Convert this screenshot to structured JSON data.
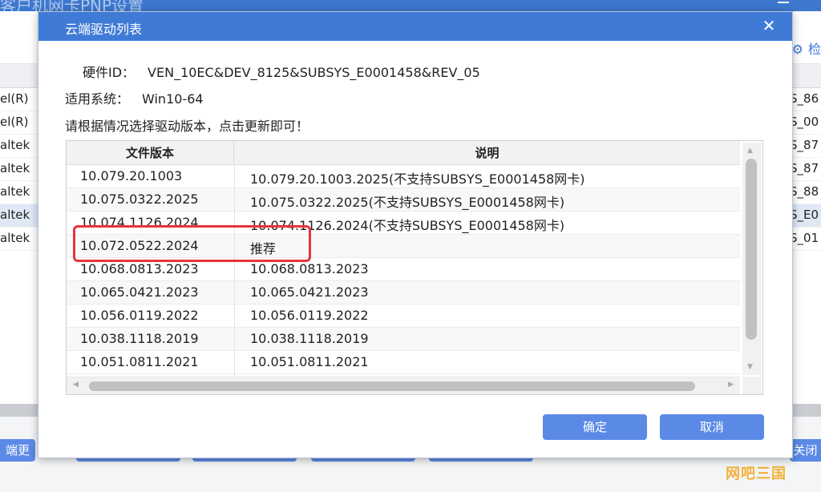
{
  "background": {
    "window_title": "客户机网卡PNP设置",
    "right_link": "检",
    "rows": [
      {
        "left": "el(R)",
        "right": "S_86"
      },
      {
        "left": "el(R)",
        "right": "S_00"
      },
      {
        "left": "altek",
        "right": "S_87"
      },
      {
        "left": "altek",
        "right": "S_87"
      },
      {
        "left": "altek",
        "right": "S_88"
      },
      {
        "left": "altek",
        "right": "S_E0",
        "selected": true
      },
      {
        "left": "altek",
        "right": "S_01"
      }
    ],
    "bottom_left_button": "端更",
    "bottom_right_button": "关闭",
    "watermark": "网吧三国"
  },
  "dialog": {
    "title": "云端驱动列表",
    "hardware_id_label": "硬件ID：",
    "hardware_id_value": "VEN_10EC&DEV_8125&SUBSYS_E0001458&REV_05",
    "os_label": "适用系统：",
    "os_value": "Win10-64",
    "instruction": "请根据情况选择驱动版本，点击更新即可！",
    "table": {
      "columns": [
        "文件版本",
        "说明"
      ],
      "rows": [
        {
          "version": "10.079.20.1003",
          "desc": "10.079.20.1003.2025(不支持SUBSYS_E0001458网卡)"
        },
        {
          "version": "10.075.0322.2025",
          "desc": "10.075.0322.2025(不支持SUBSYS_E0001458网卡)"
        },
        {
          "version": "10.074.1126.2024",
          "desc": "10.074.1126.2024(不支持SUBSYS_E0001458网卡)"
        },
        {
          "version": "10.072.0522.2024",
          "desc": "推荐"
        },
        {
          "version": "10.068.0813.2023",
          "desc": "10.068.0813.2023"
        },
        {
          "version": "10.065.0421.2023",
          "desc": "10.065.0421.2023"
        },
        {
          "version": "10.056.0119.2022",
          "desc": "10.056.0119.2022"
        },
        {
          "version": "10.038.1118.2019",
          "desc": "10.038.1118.2019"
        },
        {
          "version": "10.051.0811.2021",
          "desc": "10.051.0811.2021"
        }
      ]
    },
    "ok_label": "确定",
    "cancel_label": "取消"
  },
  "colors": {
    "accent": "#3f7bd6",
    "button": "#5b8ae6",
    "highlight": "#e8333a"
  }
}
